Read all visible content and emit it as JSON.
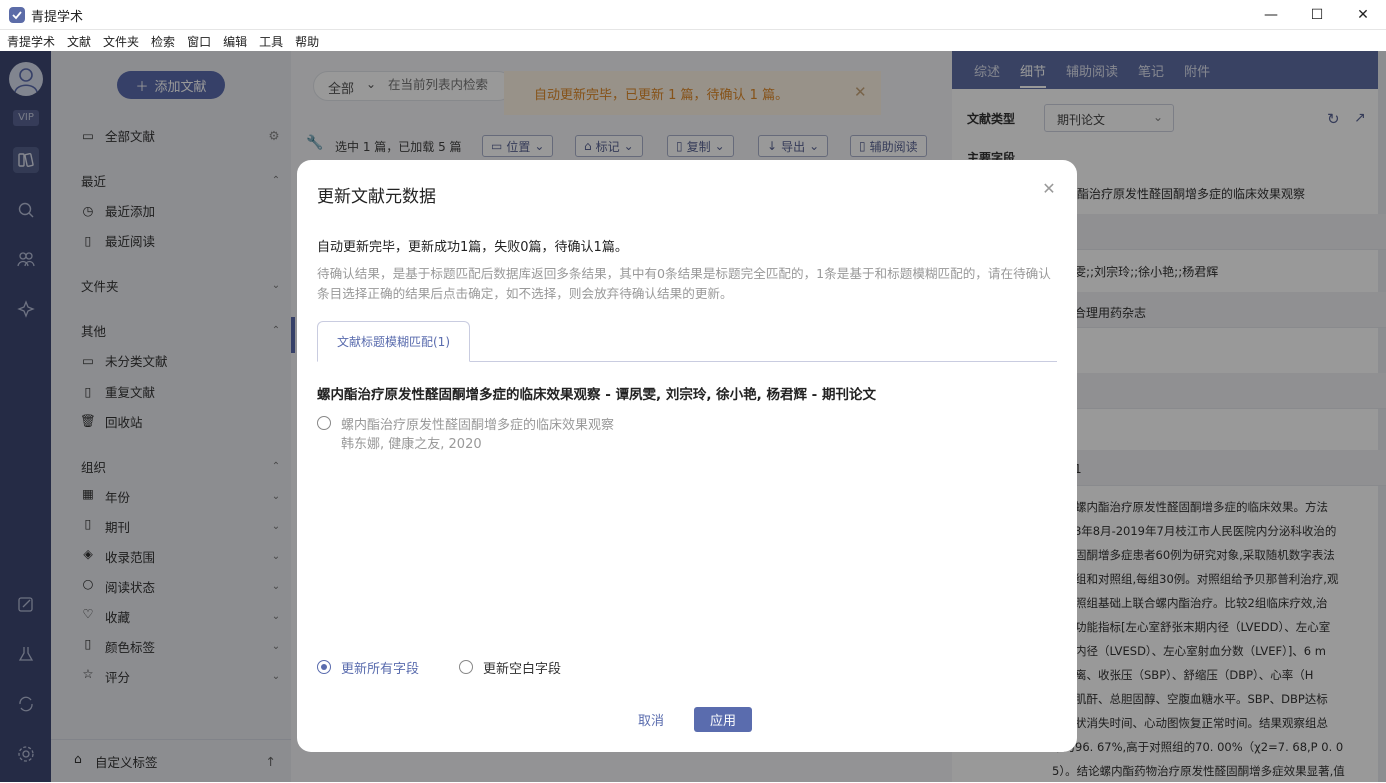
{
  "window": {
    "title": "青提学术",
    "minimize": "—",
    "maximize": "☐",
    "close": "✕"
  },
  "menu": [
    "青提学术",
    "文献",
    "文件夹",
    "检索",
    "窗口",
    "编辑",
    "工具",
    "帮助"
  ],
  "rail": {
    "vip": "VIP"
  },
  "sidebar": {
    "add_button": "添加文献",
    "all_docs": "全部文献",
    "sections": {
      "recent": {
        "title": "最近",
        "items": [
          "最近添加",
          "最近阅读"
        ]
      },
      "folder": {
        "title": "文件夹"
      },
      "other": {
        "title": "其他",
        "items": [
          "未分类文献",
          "重复文献",
          "回收站"
        ]
      },
      "org": {
        "title": "组织",
        "items": [
          "年份",
          "期刊",
          "收录范围",
          "阅读状态",
          "收藏",
          "颜色标签",
          "评分"
        ]
      }
    },
    "footer": "自定义标签"
  },
  "main": {
    "search": {
      "scope": "全部",
      "placeholder": "在当前列表内检索"
    },
    "notice": "自动更新完毕，已更新 1 篇，待确认 1 篇。",
    "status": "选中 1 篇，已加载 5 篇",
    "toolbar": [
      "位置",
      "标记",
      "复制",
      "导出",
      "辅助阅读"
    ]
  },
  "right_panel": {
    "tabs": [
      "综述",
      "细节",
      "辅助阅读",
      "笔记",
      "附件"
    ],
    "active_tab": "细节",
    "doc_type_label": "文献类型",
    "doc_type_value": "期刊论文",
    "main_fields": "主要字段",
    "title_frag": "酯治疗原发性醛固酮增多症的临床效果观察",
    "authors_frag": "雯;;刘宗玲;;徐小艳;;杨君辉",
    "journal_frag": "合理用药杂志",
    "num_frag": "1",
    "abstract_lines": [
      "观察螺内酯治疗原发性醛固酮增多症的临床效果。方法",
      "2018年8月-2019年7月枝江市人民医院内分泌科收治的",
      "性醛固酮增多症患者60例为研究对象,采取随机数字表法",
      "观察组和对照组,每组30例。对照组给予贝那普利治疗,观",
      "在对照组基础上联合螺内酯治疗。比较2组临床疗效,治",
      "后心功能指标[左心室舒张末期内径（LVEDD）、左心室",
      "末期内径（LVESD）、左心室射血分数（LVEF）]、6 m",
      "行距离、收张压（SBP）、舒缩压（DBP）、心率（H",
      "及血肌酐、总胆固醇、空腹血糖水平。SBP、DBP达标",
      "及症状消失时间、心动图恢复正常时间。结果观察组总",
      "率为96. 67%,高于对照组的70. 00%（χ2=7. 68,P 0. 0",
      "5）。结论螺内酯药物治疗原发性醛固酮增多症效果显著,值"
    ]
  },
  "dialog": {
    "title": "更新文献元数据",
    "summary": "自动更新完毕，更新成功1篇，失败0篇，待确认1篇。",
    "description": "待确认结果，是基于标题匹配后数据库返回多条结果，其中有0条结果是标题完全匹配的，1条是基于和标题模糊匹配的，请在待确认条目选择正确的结果后点击确定，如不选择，则会放弃待确认结果的更新。",
    "tab": "文献标题模糊匹配(1)",
    "reference": "螺内酯治疗原发性醛固酮增多症的临床效果观察 - 谭夙雯, 刘宗玲, 徐小艳, 杨君辉 - 期刊论文",
    "option": {
      "title": "螺内酯治疗原发性醛固酮增多症的临床效果观察",
      "meta": "韩东娜, 健康之友, 2020"
    },
    "update_all": "更新所有字段",
    "update_empty": "更新空白字段",
    "cancel": "取消",
    "apply": "应用"
  },
  "colors": {
    "accent": "#5a6cae",
    "rail": "#3e4973",
    "notice": "#e08a2a"
  }
}
